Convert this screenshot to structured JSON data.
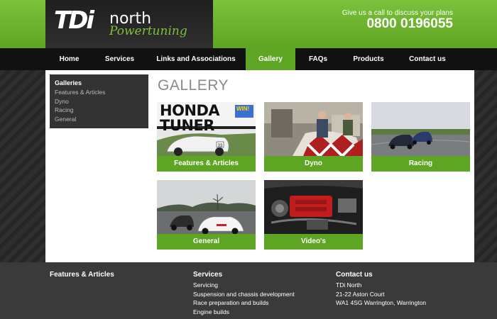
{
  "header": {
    "logo": {
      "brand": "TDi",
      "brand_suffix": "north",
      "tagline": "Powertuning"
    },
    "call_text": "Give us a call to discuss your plans",
    "phone": "0800 0196055"
  },
  "nav": {
    "items": [
      {
        "label": "Home"
      },
      {
        "label": "Services"
      },
      {
        "label": "Links and Associations"
      },
      {
        "label": "Gallery"
      },
      {
        "label": "FAQs"
      },
      {
        "label": "Products"
      },
      {
        "label": "Contact us"
      }
    ],
    "active": "Gallery"
  },
  "sidebar": {
    "title": "Galleries",
    "links": [
      "Features & Articles",
      "Dyno",
      "Racing",
      "General"
    ]
  },
  "page_title": "GALLERY",
  "gallery": {
    "tiles": [
      {
        "label": "Features & Articles",
        "image": "magazine-cover-image",
        "magazine_title": "HONDA TUNER",
        "badge": "WIN!"
      },
      {
        "label": "Dyno",
        "image": "workshop-dyno-image"
      },
      {
        "label": "Racing",
        "image": "race-track-image"
      },
      {
        "label": "General",
        "image": "cars-on-road-image"
      },
      {
        "label": "Video's",
        "image": "engine-bay-image"
      }
    ]
  },
  "footer": {
    "col1": {
      "heading": "Features & Articles"
    },
    "col2": {
      "heading": "Services",
      "links": [
        "Servicing",
        "Suspension and chassis development",
        "Race preparation and builds",
        "Engine builds"
      ]
    },
    "col3": {
      "heading": "Contact us",
      "lines": [
        "TDi North",
        "21-22 Aston Court",
        "WA1 4SG Warrington, Warrington"
      ]
    }
  },
  "colors": {
    "accent_green": "#5ea523",
    "header_green": "#7cc13a",
    "nav_bg": "#111111",
    "footer_bg": "#3a3a3a",
    "sidebar_bg": "#333333"
  }
}
